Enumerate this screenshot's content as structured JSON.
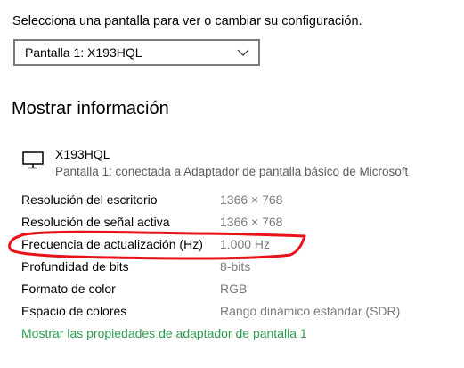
{
  "display_selector": {
    "prompt": "Selecciona una pantalla para ver o cambiar su configuración.",
    "selected": "Pantalla 1: X193HQL",
    "chevron_icon": "chevron-down-icon"
  },
  "section": {
    "title": "Mostrar información"
  },
  "display": {
    "icon": "monitor-icon",
    "name": "X193HQL",
    "description": "Pantalla 1: conectada a Adaptador de pantalla básico de Microsoft"
  },
  "info_rows": [
    {
      "label": "Resolución del escritorio",
      "value": "1366 × 768"
    },
    {
      "label": "Resolución de señal activa",
      "value": "1366 × 768"
    },
    {
      "label": "Frecuencia de actualización (Hz)",
      "value": "1.000 Hz"
    },
    {
      "label": "Profundidad de bits",
      "value": "8-bits"
    },
    {
      "label": "Formato de color",
      "value": "RGB"
    },
    {
      "label": "Espacio de colores",
      "value": "Rango dinámico estándar (SDR)"
    }
  ],
  "adapter_link": "Mostrar las propiedades de adaptador de pantalla 1",
  "colors": {
    "link": "#2e9b4f",
    "annotation": "#e8121b",
    "secondary_text": "#7a7a7a"
  }
}
